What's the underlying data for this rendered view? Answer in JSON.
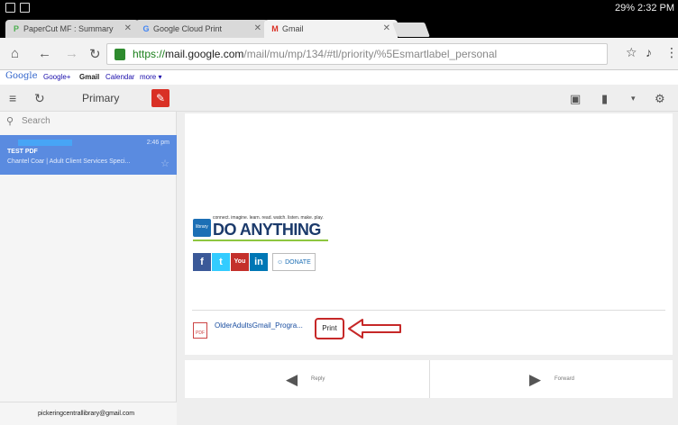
{
  "status_bar": {
    "right_text": "29% 2:32 PM"
  },
  "tabs": [
    {
      "favicon": "P",
      "title": "PaperCut MF : Summary",
      "active": false
    },
    {
      "favicon": "G",
      "title": "Google Cloud Print",
      "active": false
    },
    {
      "favicon": "M",
      "title": "Gmail",
      "active": true
    }
  ],
  "address_bar": {
    "url_scheme": "https://",
    "url_host": "mail.google.com",
    "url_path": "/mail/mu/mp/134/#tl/priority/%5Esmartlabel_personal"
  },
  "google_bar": {
    "logo": "Google",
    "links": [
      "Google+",
      "Gmail",
      "Calendar",
      "more ▾"
    ]
  },
  "gmail_header": {
    "label": "Primary"
  },
  "search": {
    "placeholder": "Search"
  },
  "mail_item": {
    "time": "2:46 pm",
    "subject": "TEST PDF",
    "snippet": "Chantel Coar | Adult Client Services Speci..."
  },
  "account": {
    "email": "pickeringcentrallibrary@gmail.com"
  },
  "message": {
    "banner_tagline": "connect. imagine. learn. read. watch. listen. make. play.",
    "banner_logo_text": "library",
    "banner_title": "DO ANYTHING",
    "social": [
      {
        "label": "f",
        "color": "#3b5998"
      },
      {
        "label": "t",
        "color": "#33ccff"
      },
      {
        "label": "You",
        "color": "#c4302b"
      },
      {
        "label": "in",
        "color": "#0077b5"
      }
    ],
    "donate_label": "☺ DONATE",
    "attachment": {
      "icon_label": "PDF",
      "name": "OlderAdultsGmail_Progra...",
      "print_label": "Print"
    }
  },
  "actions": {
    "reply_label": "Reply",
    "forward_label": "Forward"
  }
}
